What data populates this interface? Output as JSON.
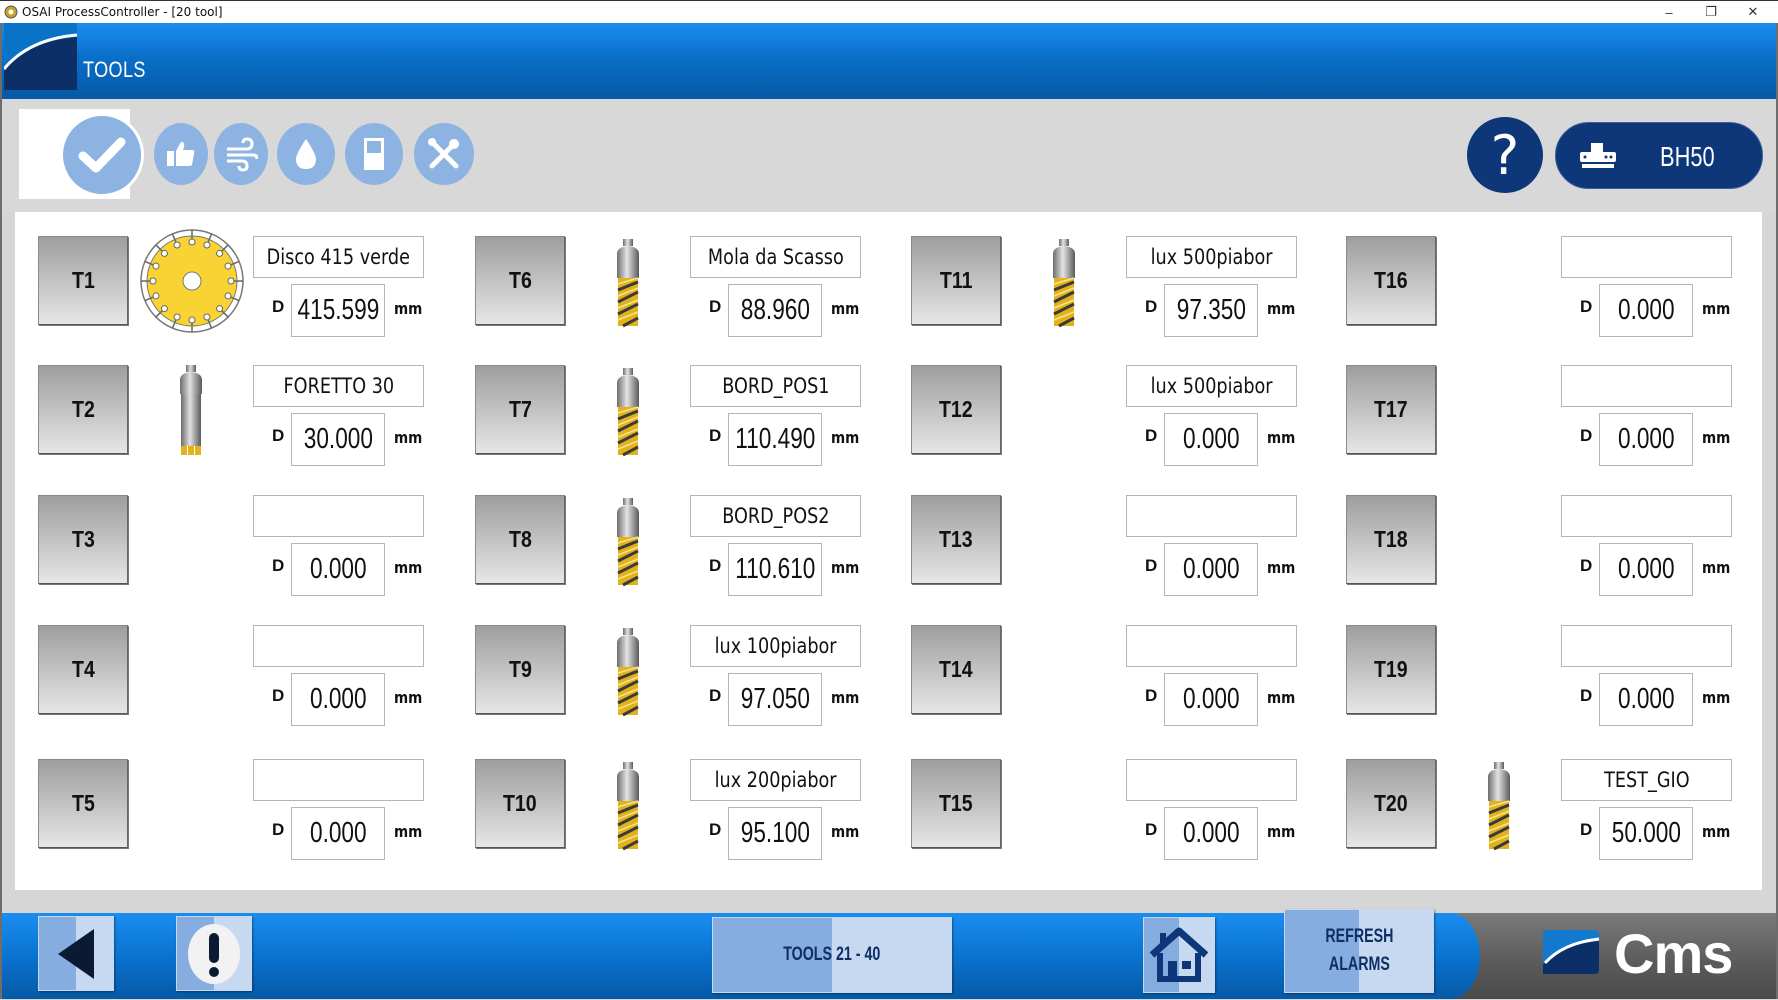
{
  "window": {
    "title": "OSAI ProcessController - [20 tool]",
    "minimize_glyph": "–",
    "restore_glyph": "❐",
    "close_glyph": "✕"
  },
  "header": {
    "title": "TOOLS"
  },
  "toolbar": {
    "icons": [
      "check-icon",
      "thumbs-up-icon",
      "wind-icon",
      "drop-icon",
      "door-icon",
      "wrench-screwdriver-icon"
    ],
    "help_label": "?",
    "machine_label": "BH50"
  },
  "labels": {
    "d": "D",
    "mm": "mm"
  },
  "tools": [
    {
      "id": "T1",
      "name": "Disco 415 verde",
      "diameter": "415.599",
      "icon": "saw-disc"
    },
    {
      "id": "T2",
      "name": "FORETTO 30",
      "diameter": "30.000",
      "icon": "drill-bit"
    },
    {
      "id": "T3",
      "name": "",
      "diameter": "0.000",
      "icon": ""
    },
    {
      "id": "T4",
      "name": "",
      "diameter": "0.000",
      "icon": ""
    },
    {
      "id": "T5",
      "name": "",
      "diameter": "0.000",
      "icon": ""
    },
    {
      "id": "T6",
      "name": "Mola da Scasso",
      "diameter": "88.960",
      "icon": "router-bit"
    },
    {
      "id": "T7",
      "name": "BORD_POS1",
      "diameter": "110.490",
      "icon": "router-bit"
    },
    {
      "id": "T8",
      "name": "BORD_POS2",
      "diameter": "110.610",
      "icon": "router-bit"
    },
    {
      "id": "T9",
      "name": "lux 100piabor",
      "diameter": "97.050",
      "icon": "router-bit"
    },
    {
      "id": "T10",
      "name": "lux 200piabor",
      "diameter": "95.100",
      "icon": "router-bit"
    },
    {
      "id": "T11",
      "name": "lux 500piabor",
      "diameter": "97.350",
      "icon": "router-bit"
    },
    {
      "id": "T12",
      "name": "lux 500piabor",
      "diameter": "0.000",
      "icon": ""
    },
    {
      "id": "T13",
      "name": "",
      "diameter": "0.000",
      "icon": ""
    },
    {
      "id": "T14",
      "name": "",
      "diameter": "0.000",
      "icon": ""
    },
    {
      "id": "T15",
      "name": "",
      "diameter": "0.000",
      "icon": ""
    },
    {
      "id": "T16",
      "name": "",
      "diameter": "0.000",
      "icon": ""
    },
    {
      "id": "T17",
      "name": "",
      "diameter": "0.000",
      "icon": ""
    },
    {
      "id": "T18",
      "name": "",
      "diameter": "0.000",
      "icon": ""
    },
    {
      "id": "T19",
      "name": "",
      "diameter": "0.000",
      "icon": ""
    },
    {
      "id": "T20",
      "name": "TEST_GIO",
      "diameter": "50.000",
      "icon": "router-bit"
    }
  ],
  "footer": {
    "tools_page_label": "TOOLS 21 - 40",
    "refresh_alarms_line1": "REFRESH",
    "refresh_alarms_line2": "ALARMS",
    "brand": "Cms"
  },
  "colors": {
    "header_blue": "#0a6fc9",
    "navy": "#0d3778",
    "toolbar_icon": "#8db3e2",
    "disc_yellow": "#f9d234",
    "bit_yellow": "#e2b21c"
  }
}
